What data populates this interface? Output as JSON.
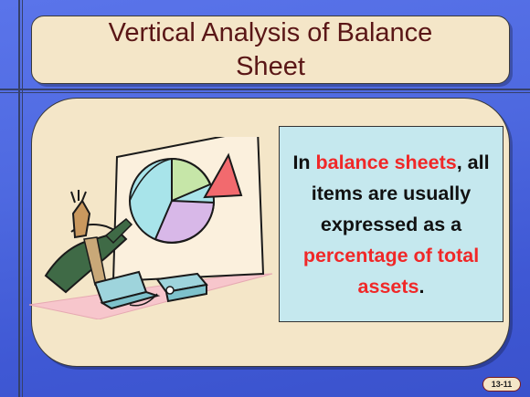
{
  "slide": {
    "title_line1": "Vertical Analysis of Balance",
    "title_line2": "Sheet",
    "callout": {
      "p1": "In ",
      "h1": "balance sheets",
      "p2": ", all items are usually expressed as a ",
      "h2": "percentage of total assets",
      "p3": "."
    },
    "slide_number": "13-11"
  },
  "colors": {
    "background": "#4e69e0",
    "panel": "#f4e6c8",
    "title_text": "#5a1616",
    "callout_fill": "#c5e8ee",
    "highlight_text": "#f02828"
  },
  "icons": [
    "presenter-clipart",
    "pie-chart-icon",
    "laptop-icon",
    "projector-icon"
  ]
}
